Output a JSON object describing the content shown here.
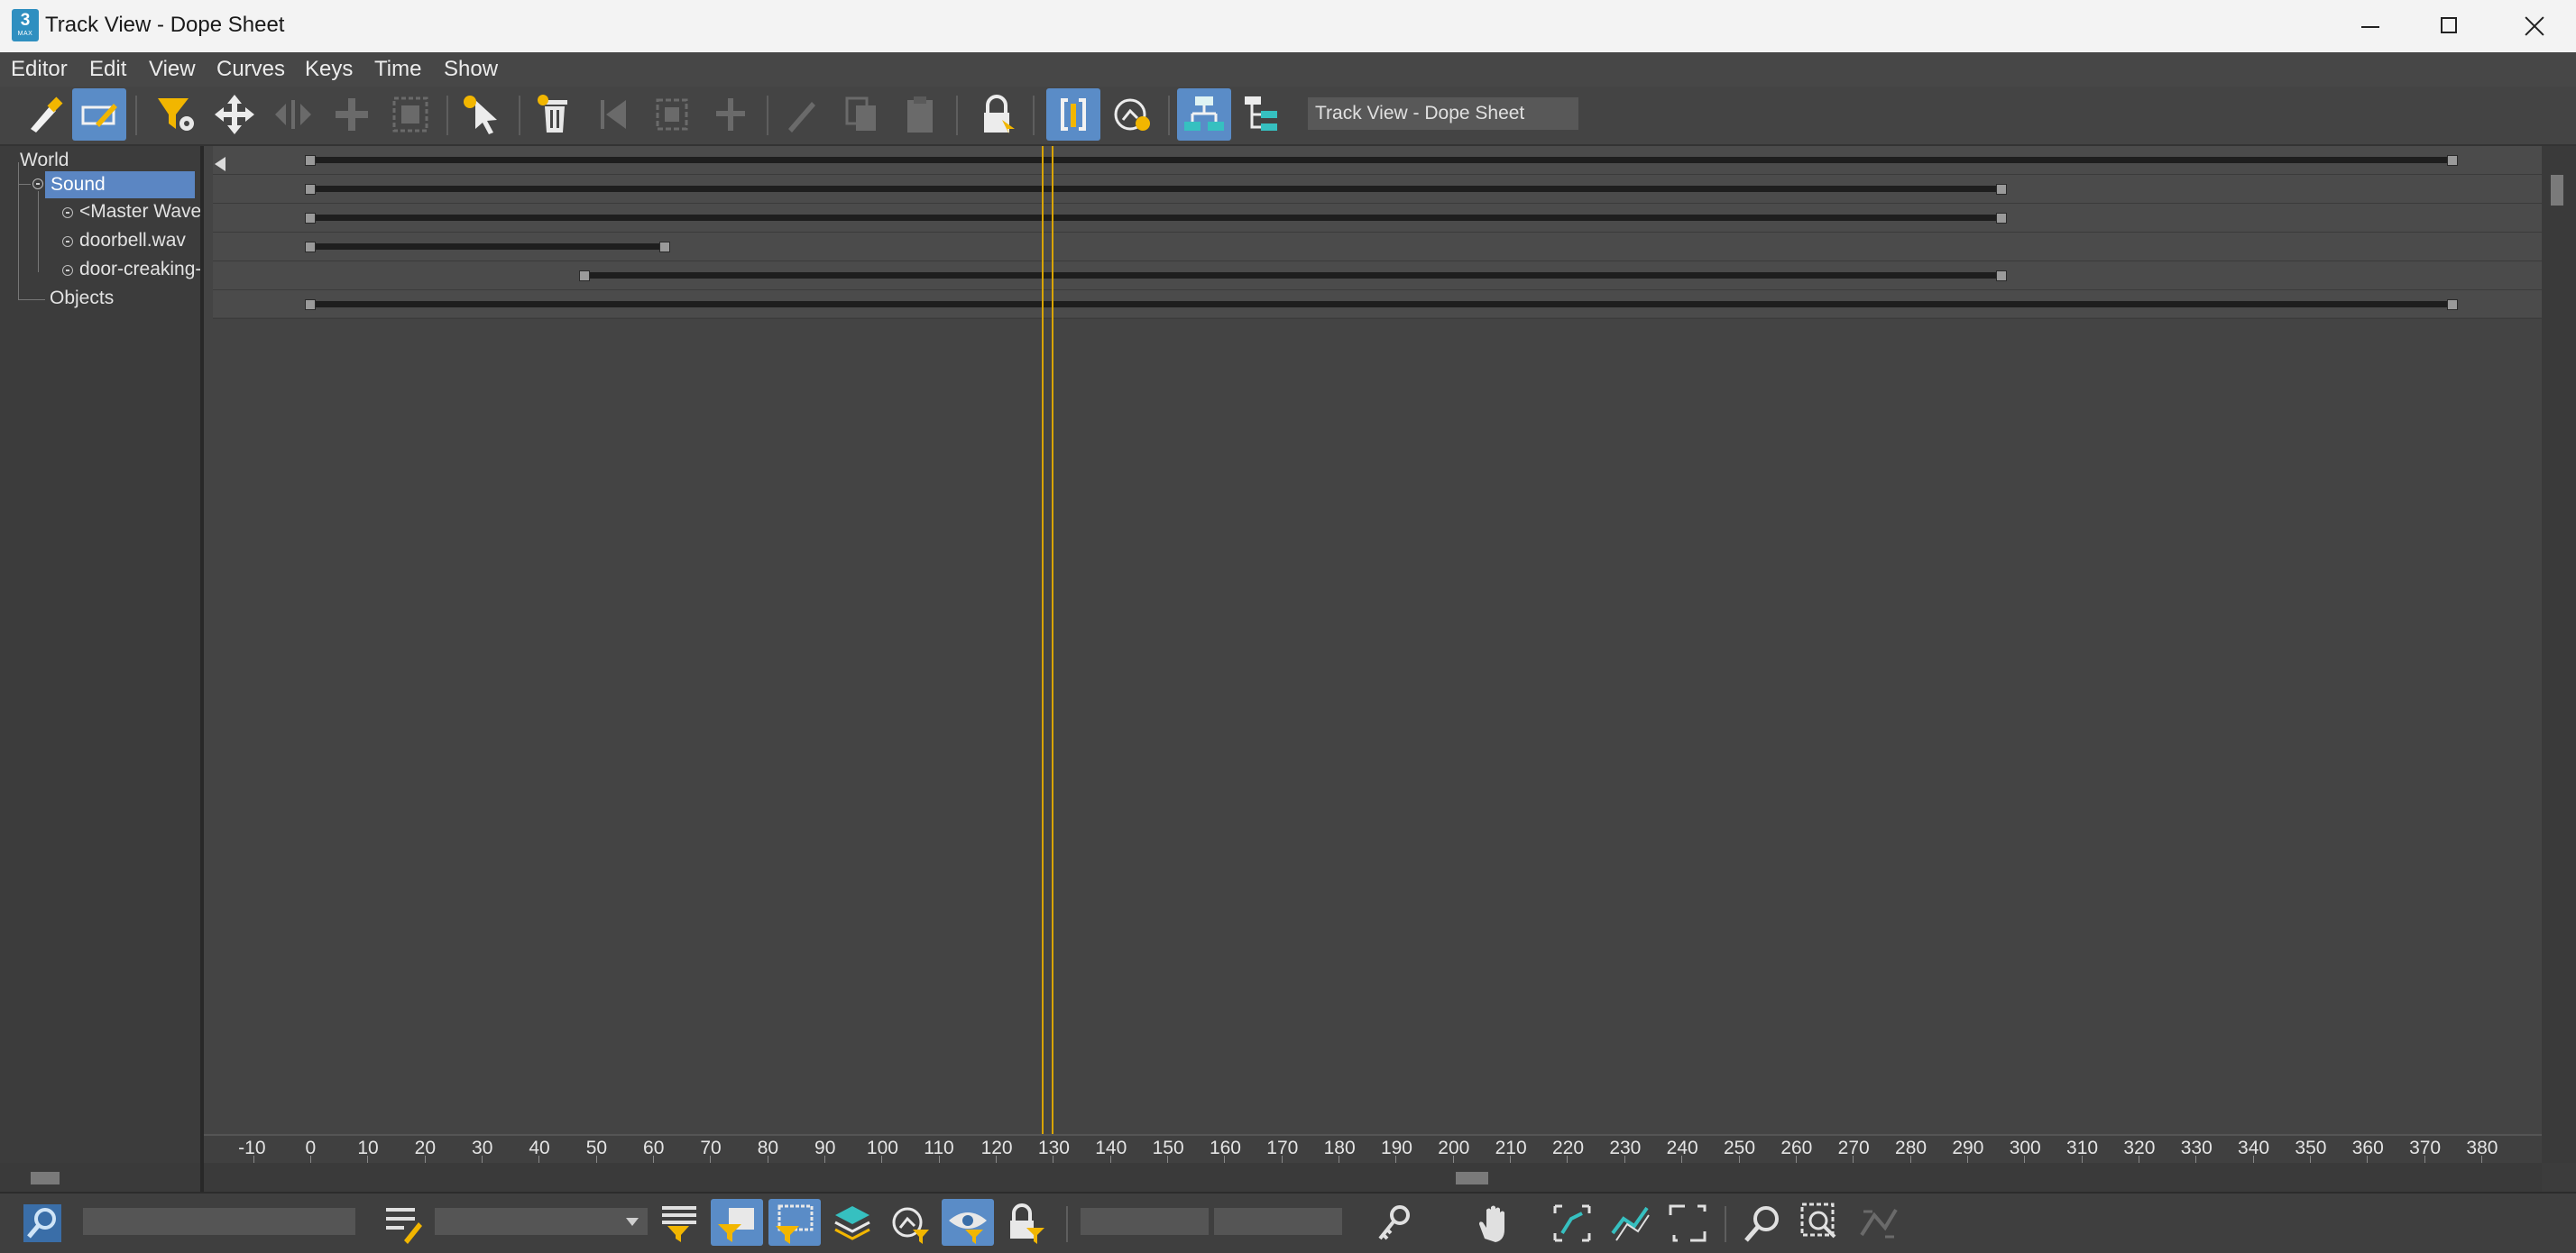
{
  "window": {
    "title": "Track View - Dope Sheet",
    "app_icon_number": "3",
    "app_icon_sub": "MAX"
  },
  "menu": [
    "Editor",
    "Edit",
    "View",
    "Curves",
    "Keys",
    "Time",
    "Show"
  ],
  "toolbar": {
    "name_field": "Track View - Dope Sheet"
  },
  "tree": {
    "world": "World",
    "sound": "Sound",
    "master_wave": "<Master Wave",
    "doorbell": "doorbell.wav",
    "door_creaking": "door-creaking-",
    "objects": "Objects"
  },
  "timeline": {
    "current_frame": 130,
    "ticks": [
      "-10",
      "0",
      "10",
      "20",
      "30",
      "40",
      "50",
      "60",
      "70",
      "80",
      "90",
      "100",
      "110",
      "120",
      "130",
      "140",
      "150",
      "160",
      "170",
      "180",
      "190",
      "200",
      "210",
      "220",
      "230",
      "240",
      "250",
      "260",
      "270",
      "280",
      "290",
      "300",
      "310",
      "320",
      "330",
      "340",
      "350",
      "360",
      "370",
      "380"
    ],
    "ranges": [
      {
        "track": "world",
        "start": 0,
        "end": 375
      },
      {
        "track": "sound",
        "start": 0,
        "end": 296
      },
      {
        "track": "master_wave",
        "start": 0,
        "end": 296
      },
      {
        "track": "doorbell",
        "start": 0,
        "end": 62
      },
      {
        "track": "door_creaking",
        "start": 48,
        "end": 296
      },
      {
        "track": "objects",
        "start": 0,
        "end": 375
      }
    ]
  },
  "colors": {
    "selection": "#5b86c3",
    "time_slider": "#d9a400",
    "toggle_on": "#5a8cc7",
    "icon_yellow": "#f2b600"
  }
}
